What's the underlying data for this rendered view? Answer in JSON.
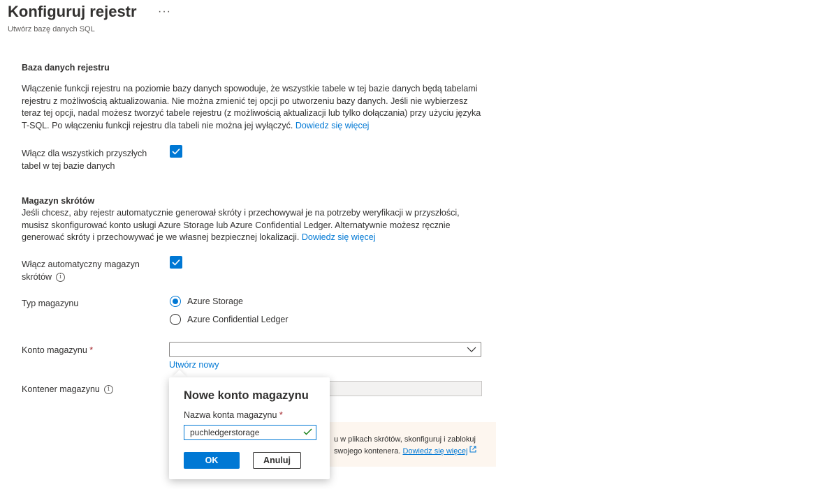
{
  "header": {
    "title": "Konfiguruj rejestr",
    "more": "···",
    "subtitle": "Utwórz bazę danych SQL"
  },
  "ledger_db": {
    "heading": "Baza danych rejestru",
    "description": "Włączenie funkcji rejestru na poziomie bazy danych spowoduje, że wszystkie tabele w tej bazie danych będą tabelami rejestru z możliwością aktualizowania. Nie można zmienić tej opcji po utworzeniu bazy danych. Jeśli nie wybierzesz teraz tej opcji, nadal możesz tworzyć tabele rejestru (z możliwością aktualizacji lub tylko dołączania) przy użyciu języka T-SQL. Po włączeniu funkcji rejestru dla tabeli nie można jej wyłączyć.",
    "learn_more": "Dowiedz się więcej",
    "enable_label": "Włącz dla wszystkich przyszłych tabel w tej bazie danych",
    "enable_checked": true
  },
  "digest_storage": {
    "heading": "Magazyn skrótów",
    "description": "Jeśli chcesz, aby rejestr automatycznie generował skróty i przechowywał je na potrzeby weryfikacji w przyszłości, musisz skonfigurować konto usługi Azure Storage lub Azure Confidential Ledger. Alternatywnie możesz ręcznie generować skróty i przechowywać je we własnej bezpiecznej lokalizacji.",
    "learn_more": "Dowiedz się więcej",
    "auto_label": "Włącz automatyczny magazyn skrótów",
    "auto_checked": true,
    "storage_type_label": "Typ magazynu",
    "storage_type_options": [
      "Azure Storage",
      "Azure Confidential Ledger"
    ],
    "storage_type_selected": "Azure Storage",
    "account_label": "Konto magazynu",
    "account_value": "",
    "required_mark": "*",
    "create_new": "Utwórz nowy",
    "container_label": "Kontener magazynu",
    "container_value": ""
  },
  "warning": {
    "text_line1": "u w plikach skrótów, skonfiguruj i zablokuj",
    "text_line2": "swojego kontenera.",
    "link": "Dowiedz się więcej"
  },
  "popup": {
    "title": "Nowe konto magazynu",
    "name_label": "Nazwa konta magazynu",
    "required_mark": "*",
    "name_value": "puchledgerstorage",
    "ok_label": "OK",
    "cancel_label": "Anuluj"
  },
  "colors": {
    "accent": "#0078d4",
    "required": "#a4262c",
    "valid": "#107c10",
    "warning_bg": "#fdf6ef"
  }
}
